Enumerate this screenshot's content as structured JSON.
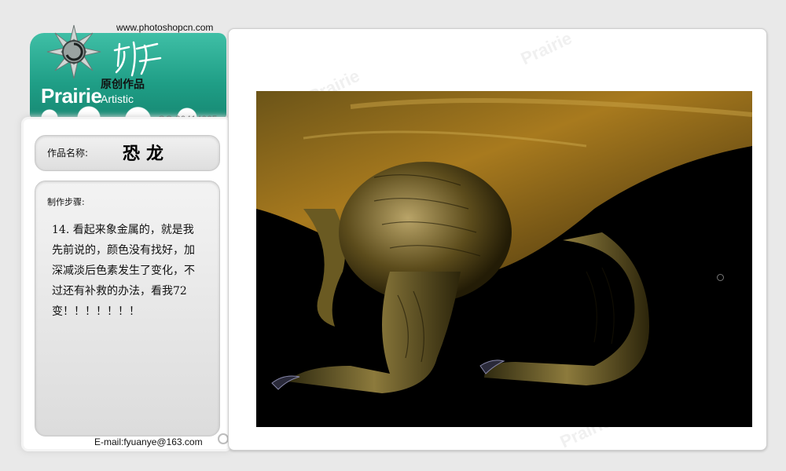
{
  "header": {
    "site_url": "www.photoshopcn.com",
    "qq": "QQ:20414065"
  },
  "logo": {
    "brand_word": "Prairie",
    "brand_sub": "Artistic",
    "cn_label": "原创作品",
    "script_text": "原野",
    "color_teal": "#1f9e86"
  },
  "work": {
    "name_label": "作品名称:",
    "name_value": "恐龙"
  },
  "steps": {
    "label": "制作步骤:",
    "text": "14. 看起来象金属的，就是我先前说的，颜色没有找好，加深减淡后色素发生了变化，不过还有补救的办法，看我72变！！！！！！！"
  },
  "footer": {
    "email": "E-mail:fyuanye@163.com"
  },
  "artwork": {
    "subject": "dinosaur-illustration",
    "background_color": "#000000"
  },
  "watermarks": [
    "Prairie",
    "Prairie",
    "Prairie"
  ]
}
